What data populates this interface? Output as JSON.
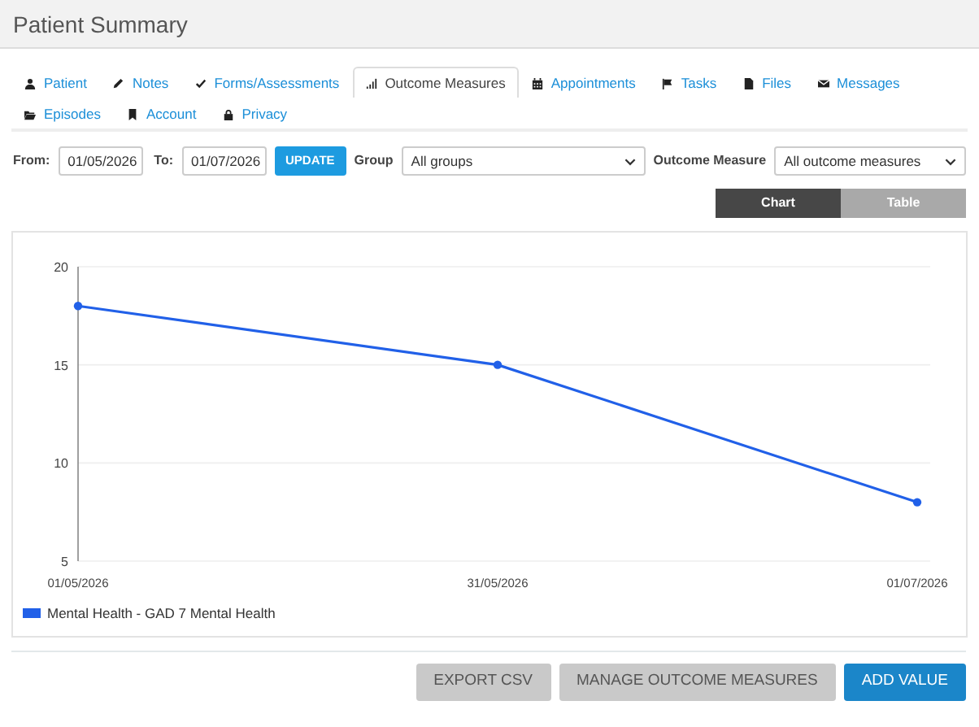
{
  "header": {
    "title": "Patient Summary"
  },
  "tabs": [
    {
      "label": "Patient",
      "selected": false
    },
    {
      "label": "Notes",
      "selected": false
    },
    {
      "label": "Forms/Assessments",
      "selected": false
    },
    {
      "label": "Outcome Measures",
      "selected": true
    },
    {
      "label": "Appointments",
      "selected": false
    },
    {
      "label": "Tasks",
      "selected": false
    },
    {
      "label": "Files",
      "selected": false
    },
    {
      "label": "Messages",
      "selected": false
    },
    {
      "label": "Episodes",
      "selected": false
    },
    {
      "label": "Account",
      "selected": false
    },
    {
      "label": "Privacy",
      "selected": false
    }
  ],
  "filters": {
    "from_label": "From:",
    "from_value": "01/05/2026",
    "to_label": "To:",
    "to_value": "01/07/2026",
    "update_button": "UPDATE",
    "group_label": "Group",
    "group_value": "All groups",
    "measure_label": "Outcome Measure",
    "measure_value": "All outcome measures"
  },
  "view_toggle": [
    {
      "label": "Chart",
      "selected": true
    },
    {
      "label": "Table",
      "selected": false
    }
  ],
  "chart": {
    "chart_data": {
      "type": "line",
      "categories": [
        "01/05/2026",
        "31/05/2026",
        "01/07/2026"
      ],
      "series": [
        {
          "name": "Mental Health - GAD 7 Mental Health",
          "color": "#2160e8",
          "marker": "circle",
          "values": [
            18,
            15,
            8
          ]
        }
      ],
      "ylim": [
        5,
        20
      ],
      "yticks": [
        5,
        10,
        15,
        20
      ]
    }
  },
  "actions": [
    {
      "label": "EXPORT CSV",
      "kind": "secondary"
    },
    {
      "label": "MANAGE OUTCOME MEASURES",
      "kind": "secondary"
    },
    {
      "label": "ADD VALUE",
      "kind": "primary"
    }
  ]
}
